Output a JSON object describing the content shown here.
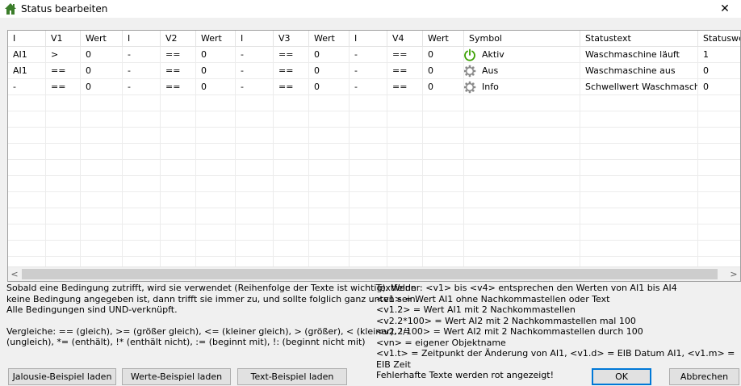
{
  "window": {
    "title": "Status bearbeiten",
    "close_symbol": "✕",
    "icon": "home-icon"
  },
  "table": {
    "headers": [
      "I",
      "V1",
      "Wert",
      "I",
      "V2",
      "Wert",
      "I",
      "V3",
      "Wert",
      "I",
      "V4",
      "Wert",
      "Symbol",
      "Statustext",
      "Statuswe"
    ],
    "rows": [
      {
        "cells": [
          "AI1",
          ">",
          "0",
          "-",
          "==",
          "0",
          "-",
          "==",
          "0",
          "-",
          "==",
          "0"
        ],
        "symbol_label": "Aktiv",
        "symbol_icon": "power-green-icon",
        "statustext": "Waschmaschine läuft",
        "statuswert": "1"
      },
      {
        "cells": [
          "AI1",
          "==",
          "0",
          "-",
          "==",
          "0",
          "-",
          "==",
          "0",
          "-",
          "==",
          "0"
        ],
        "symbol_label": "Aus",
        "symbol_icon": "gear-grey-icon",
        "statustext": "Waschmaschine aus",
        "statuswert": "0"
      },
      {
        "cells": [
          "-",
          "==",
          "0",
          "-",
          "==",
          "0",
          "-",
          "==",
          "0",
          "-",
          "==",
          "0"
        ],
        "symbol_label": "Info",
        "symbol_icon": "gear-grey-icon",
        "statustext": "Schwellwert Waschmasch…",
        "statuswert": "0"
      }
    ]
  },
  "help_left": {
    "line1": "Sobald eine Bedingung zutrifft, wird sie verwendet (Reihenfolge der Texte ist wichtig). Wenn",
    "line2": "keine Bedingung angegeben ist, dann trifft sie immer zu, und sollte folglich ganz unten sein.",
    "line3": "Alle Bedingungen sind UND-verknüpft.",
    "line4": "Vergleiche: == (gleich), >= (größer gleich), <= (kleiner gleich), > (größer), < (kleiner), !=",
    "line5": "(ungleich), *= (enthält), !* (enthält nicht), := (beginnt mit), !: (beginnt nicht mit)"
  },
  "help_right": {
    "line1": "Textfelder: <v1> bis <v4> entsprechen den Werten von AI1 bis AI4",
    "line2": "<v1> = Wert AI1 ohne Nachkommastellen oder Text",
    "line3": "<v1.2> = Wert AI1 mit 2 Nachkommastellen",
    "line4": "<v2.2*100> = Wert AI2 mit 2 Nachkommastellen mal 100",
    "line5": "<v2.2/100> = Wert AI2 mit 2 Nachkommastellen durch 100",
    "line6": "<vn> = eigener Objektname",
    "line7": "<v1.t> = Zeitpunkt der Änderung von AI1, <v1.d> = EIB Datum AI1, <v1.m> = EIB Zeit",
    "line8": "Fehlerhafte Texte werden rot angezeigt!"
  },
  "buttons": {
    "jalousie": "Jalousie-Beispiel laden",
    "werte": "Werte-Beispiel laden",
    "text": "Text-Beispiel laden",
    "ok": "OK",
    "cancel": "Abbrechen"
  },
  "colors": {
    "accent": "#0078d7",
    "power_green": "#3aa000",
    "gear_grey": "#8a8a8a"
  }
}
